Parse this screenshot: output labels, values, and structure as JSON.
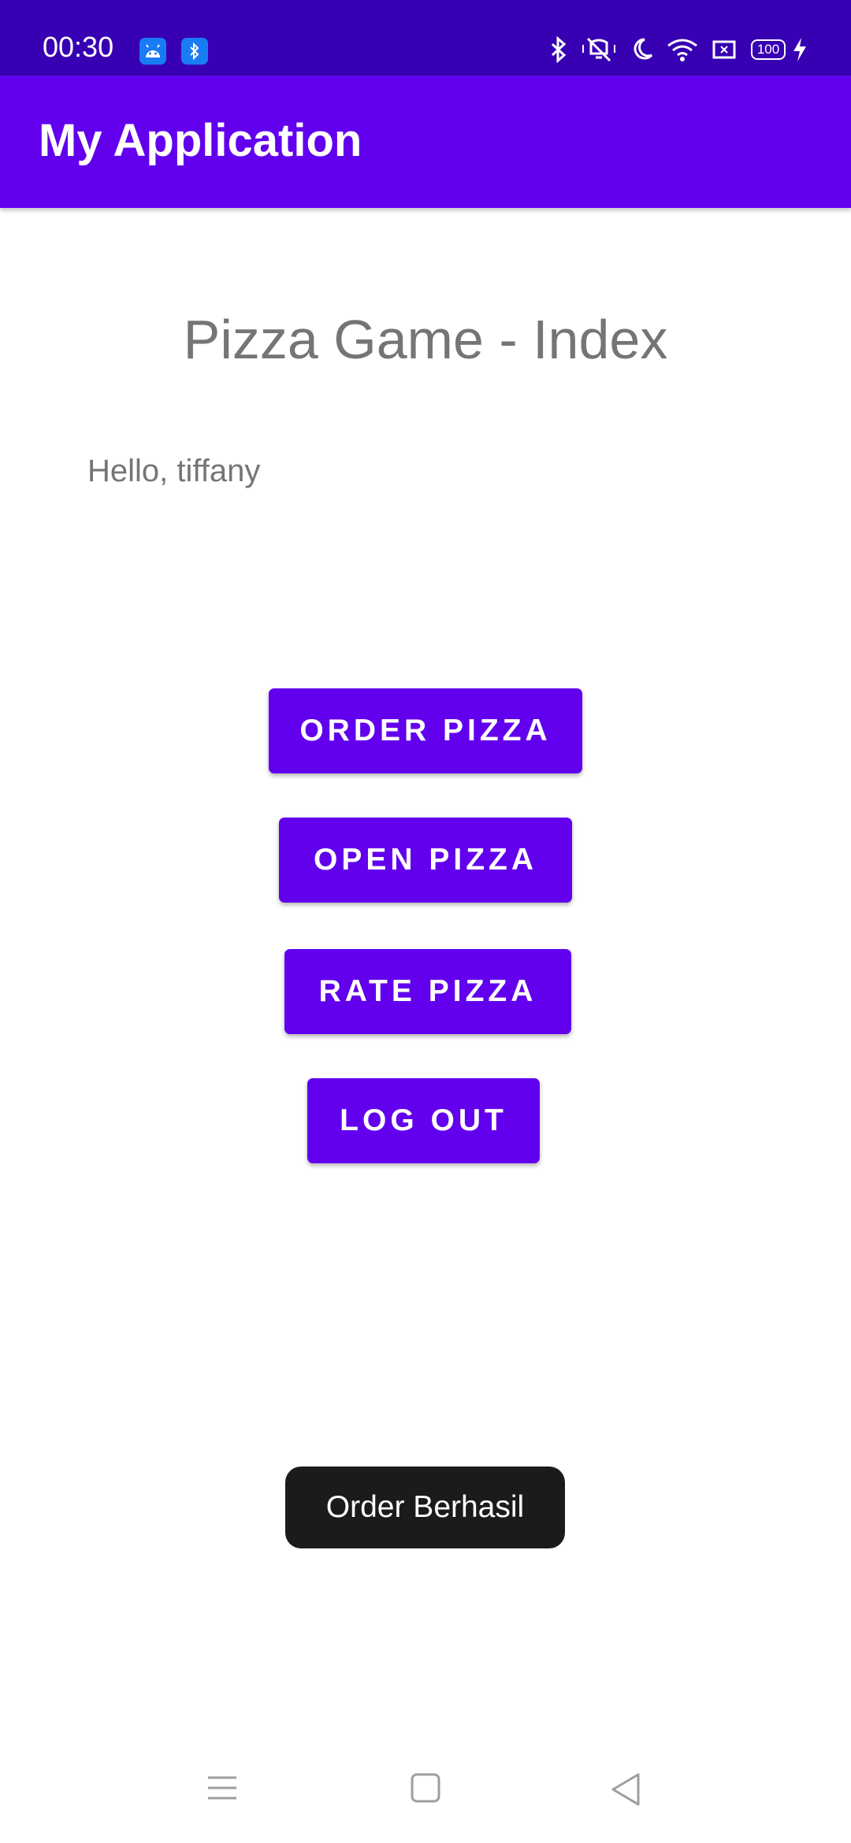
{
  "status_bar": {
    "time": "00:30",
    "battery_level": "100",
    "notification_icons": [
      "android-icon",
      "bluetooth-settings-icon"
    ],
    "system_icons": [
      "bluetooth-icon",
      "vibrate-off-icon",
      "moon-icon",
      "wifi-icon",
      "sim-icon",
      "battery-icon",
      "charging-icon"
    ]
  },
  "app_bar": {
    "title": "My Application"
  },
  "main": {
    "title": "Pizza Game - Index",
    "greeting": "Hello, tiffany",
    "buttons": {
      "order": "ORDER PIZZA",
      "open": "OPEN PIZZA",
      "rate": "RATE PIZZA",
      "logout": "LOG OUT"
    }
  },
  "toast": {
    "message": "Order Berhasil"
  },
  "nav_bar": {
    "icons": [
      "menu-icon",
      "home-icon",
      "back-icon"
    ]
  },
  "colors": {
    "status_bar": "#3700b3",
    "primary": "#6200ee",
    "toast_bg": "#1b1b1b",
    "text_secondary": "#757575"
  }
}
